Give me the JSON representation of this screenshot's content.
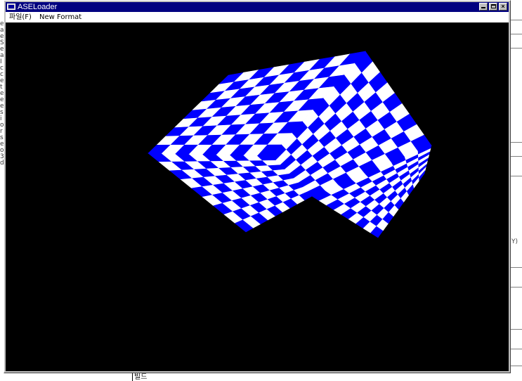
{
  "window": {
    "title": "ASELoader",
    "controls": {
      "minimize": "minimize",
      "maximize": "maximize",
      "close": "×"
    }
  },
  "menubar": {
    "items": [
      "파일(F)",
      "New Format"
    ]
  },
  "background": {
    "left_glyphs": [
      "e",
      "a",
      "e",
      "S",
      "e",
      "a",
      "I",
      "c",
      "c",
      "e",
      "t",
      "e",
      "e",
      "e",
      "s",
      "i",
      "o",
      "r",
      "s",
      "e",
      "o",
      "3",
      "d"
    ],
    "right_text": "Y)",
    "bottom_text": "빌드"
  },
  "scene": {
    "object": "checkered cube",
    "colors": {
      "background": "#000000",
      "checker_a": "#0000ff",
      "checker_b": "#ffffff"
    }
  }
}
